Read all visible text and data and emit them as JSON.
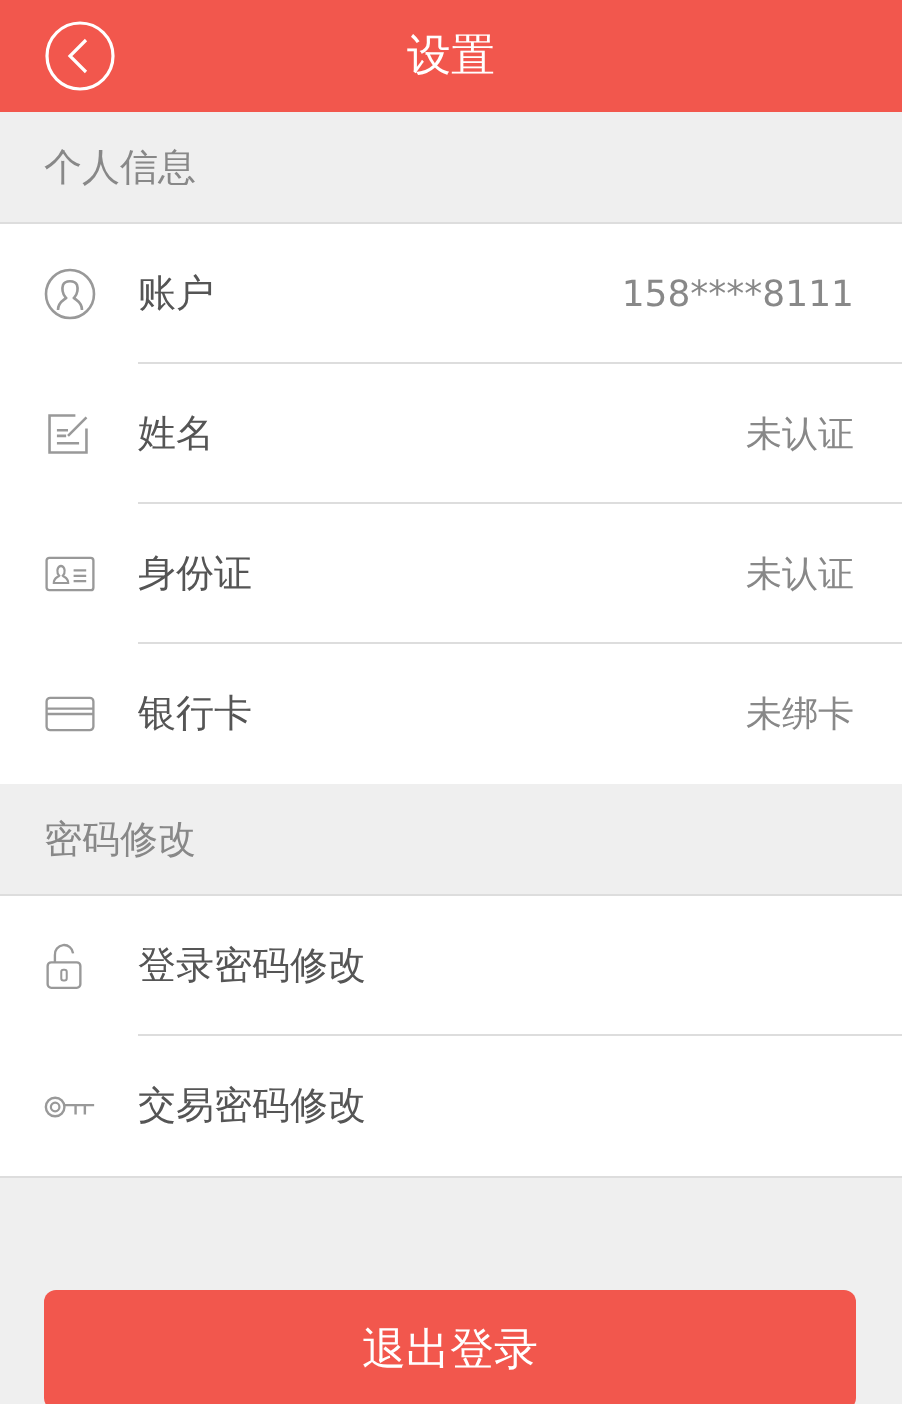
{
  "header": {
    "title": "设置"
  },
  "sections": [
    {
      "title": "个人信息",
      "items": [
        {
          "kind": "account",
          "label": "账户",
          "value": "158****8111"
        },
        {
          "kind": "name",
          "label": "姓名",
          "value": "未认证"
        },
        {
          "kind": "idcard",
          "label": "身份证",
          "value": "未认证"
        },
        {
          "kind": "bankcard",
          "label": "银行卡",
          "value": "未绑卡"
        }
      ]
    },
    {
      "title": "密码修改",
      "items": [
        {
          "kind": "lock",
          "label": "登录密码修改"
        },
        {
          "kind": "key",
          "label": "交易密码修改"
        }
      ]
    }
  ],
  "logout_button": "退出登录"
}
